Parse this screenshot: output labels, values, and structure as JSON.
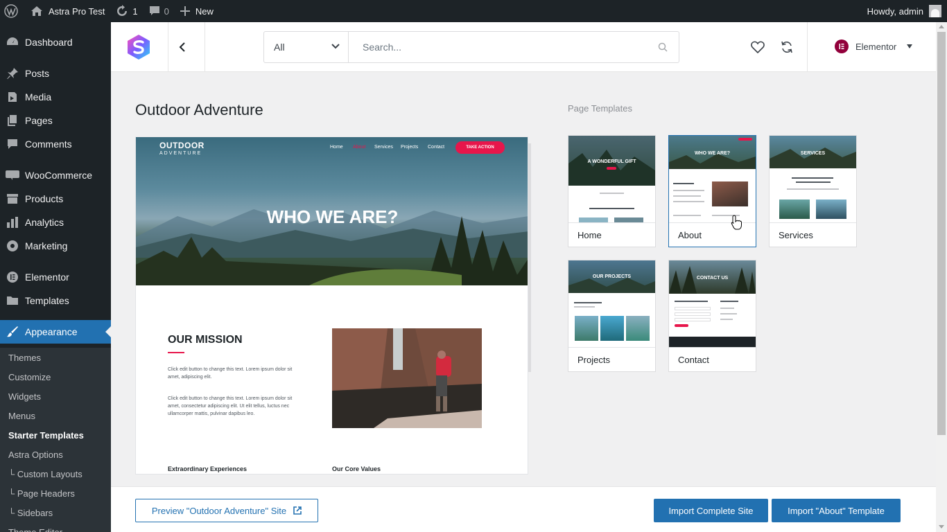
{
  "adminbar": {
    "site_name": "Astra Pro Test",
    "updates_count": "1",
    "comments_count": "0",
    "new_label": "New",
    "greeting": "Howdy, admin"
  },
  "sidebar": {
    "items": [
      {
        "label": "Dashboard",
        "icon": "dashboard-icon"
      },
      {
        "label": "Posts",
        "icon": "pin-icon"
      },
      {
        "label": "Media",
        "icon": "media-icon"
      },
      {
        "label": "Pages",
        "icon": "pages-icon"
      },
      {
        "label": "Comments",
        "icon": "comment-icon"
      },
      {
        "label": "WooCommerce",
        "icon": "woo-icon"
      },
      {
        "label": "Products",
        "icon": "archive-icon"
      },
      {
        "label": "Analytics",
        "icon": "chart-icon"
      },
      {
        "label": "Marketing",
        "icon": "megaphone-icon"
      },
      {
        "label": "Elementor",
        "icon": "elementor-icon"
      },
      {
        "label": "Templates",
        "icon": "folder-icon"
      },
      {
        "label": "Appearance",
        "icon": "brush-icon"
      }
    ],
    "submenu": [
      "Themes",
      "Customize",
      "Widgets",
      "Menus",
      "Starter Templates",
      "Astra Options",
      "└ Custom Layouts",
      "└ Page Headers",
      "└ Sidebars",
      "Theme Editor"
    ]
  },
  "topbar": {
    "filter_value": "All",
    "search_placeholder": "Search...",
    "builder_label": "Elementor"
  },
  "content": {
    "site_title": "Outdoor Adventure",
    "templates_heading": "Page Templates"
  },
  "preview": {
    "logo_main": "OUTDOOR",
    "logo_sub": "ADVENTURE",
    "nav": [
      "Home",
      "About",
      "Services",
      "Projects",
      "Contact"
    ],
    "cta": "TAKE ACTION",
    "hero_title": "WHO WE ARE?",
    "mission_title": "OUR MISSION",
    "mission_text_1": "Click edit button to change this text. Lorem ipsum dolor sit amet, adipiscing elit.",
    "mission_text_2": "Click edit button to change this text. Lorem ipsum dolor sit amet, consectetur adipiscing elit. Ut elit tellus, luctus nec ullamcorper mattis, pulvinar dapibus leo.",
    "heading_left": "Extraordinary Experiences",
    "heading_right": "Our Core Values"
  },
  "templates": [
    {
      "label": "Home",
      "hero_text": "A WONDERFUL GIFT",
      "selected": false
    },
    {
      "label": "About",
      "hero_text": "WHO WE ARE?",
      "selected": true
    },
    {
      "label": "Services",
      "hero_text": "SERVICES",
      "selected": false
    },
    {
      "label": "Projects",
      "hero_text": "OUR PROJECTS",
      "selected": false
    },
    {
      "label": "Contact",
      "hero_text": "CONTACT US",
      "selected": false
    }
  ],
  "footer": {
    "preview_button": "Preview \"Outdoor Adventure\" Site",
    "import_site_button": "Import Complete Site",
    "import_template_button": "Import \"About\" Template"
  },
  "colors": {
    "wp_dark": "#1d2327",
    "wp_blue": "#2271b1",
    "accent_pink": "#e7164b",
    "elementor": "#92003b"
  }
}
